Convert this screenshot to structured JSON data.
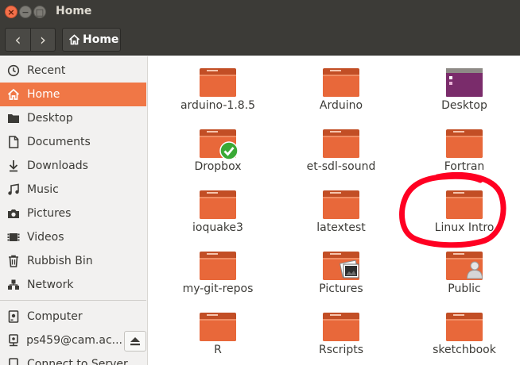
{
  "window": {
    "title": "Home",
    "close_glyph": "×",
    "min_glyph": "−",
    "max_glyph": "□"
  },
  "toolbar": {
    "back_glyph": "‹",
    "forward_glyph": "›",
    "path_label": "Home"
  },
  "sidebar": {
    "items": [
      {
        "label": "Recent",
        "icon": "clock-icon"
      },
      {
        "label": "Home",
        "icon": "home-icon",
        "active": true
      },
      {
        "label": "Desktop",
        "icon": "folder-icon"
      },
      {
        "label": "Documents",
        "icon": "document-icon"
      },
      {
        "label": "Downloads",
        "icon": "download-icon"
      },
      {
        "label": "Music",
        "icon": "music-icon"
      },
      {
        "label": "Pictures",
        "icon": "camera-icon"
      },
      {
        "label": "Videos",
        "icon": "video-icon"
      },
      {
        "label": "Rubbish Bin",
        "icon": "trash-icon"
      },
      {
        "label": "Network",
        "icon": "network-icon"
      },
      {
        "label": "Computer",
        "icon": "drive-icon"
      },
      {
        "label": "ps459@cam.ac...",
        "icon": "remote-drive-icon"
      },
      {
        "label": "Connect to Server",
        "icon": "connect-server-icon"
      }
    ]
  },
  "files": [
    {
      "label": "arduino-1.8.5",
      "kind": "folder"
    },
    {
      "label": "Arduino",
      "kind": "folder"
    },
    {
      "label": "Desktop",
      "kind": "desktop"
    },
    {
      "label": "Dropbox",
      "kind": "dropbox"
    },
    {
      "label": "et-sdl-sound",
      "kind": "folder"
    },
    {
      "label": "Fortran",
      "kind": "folder"
    },
    {
      "label": "ioquake3",
      "kind": "folder"
    },
    {
      "label": "latextest",
      "kind": "folder"
    },
    {
      "label": "Linux Intro",
      "kind": "folder"
    },
    {
      "label": "my-git-repos",
      "kind": "folder"
    },
    {
      "label": "Pictures",
      "kind": "pictures"
    },
    {
      "label": "Public",
      "kind": "public"
    },
    {
      "label": "R",
      "kind": "folder"
    },
    {
      "label": "Rscripts",
      "kind": "folder"
    },
    {
      "label": "sketchbook",
      "kind": "folder"
    }
  ],
  "colors": {
    "accent": "#f07746",
    "folder_body": "#e8683a",
    "folder_tab": "#c24e25",
    "desktop_folder": "#7a2c6b",
    "annotation": "#ff0022"
  }
}
